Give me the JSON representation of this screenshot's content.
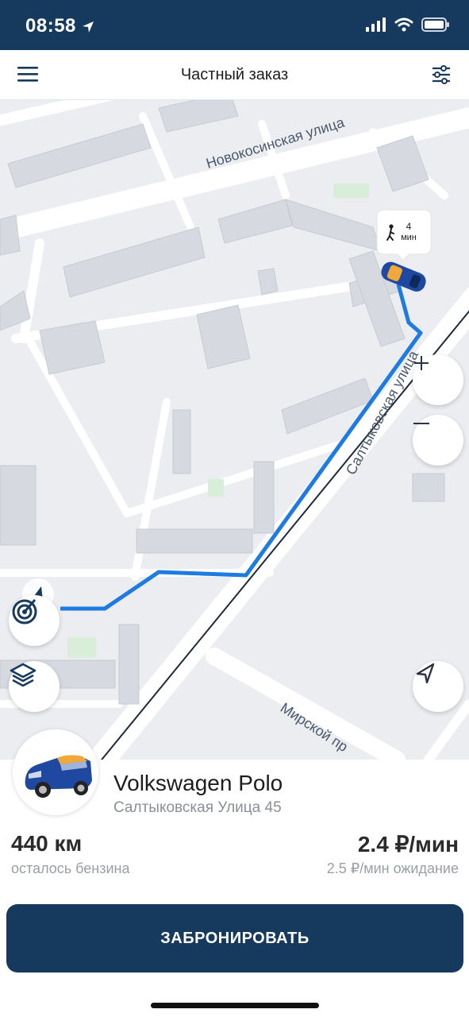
{
  "status_bar": {
    "time": "08:58"
  },
  "header": {
    "title": "Частный заказ"
  },
  "map": {
    "street_labels": [
      "Новокосинская улица",
      "Салтыковская улица",
      "Мирской пр"
    ],
    "walk_badge": {
      "value": "4",
      "unit": "мин"
    }
  },
  "car": {
    "name": "Volkswagen Polo",
    "address": "Салтыковская Улица 45"
  },
  "stats": {
    "fuel_value": "440 км",
    "fuel_label": "осталось бензина",
    "price_value": "2.4 ₽/мин",
    "price_label": "2.5 ₽/мин ожидание"
  },
  "actions": {
    "book_label": "ЗАБРОНИРОВАТЬ"
  },
  "colors": {
    "brand": "#163a5e",
    "route": "#1e7be0",
    "car_body": "#1f48a0"
  }
}
